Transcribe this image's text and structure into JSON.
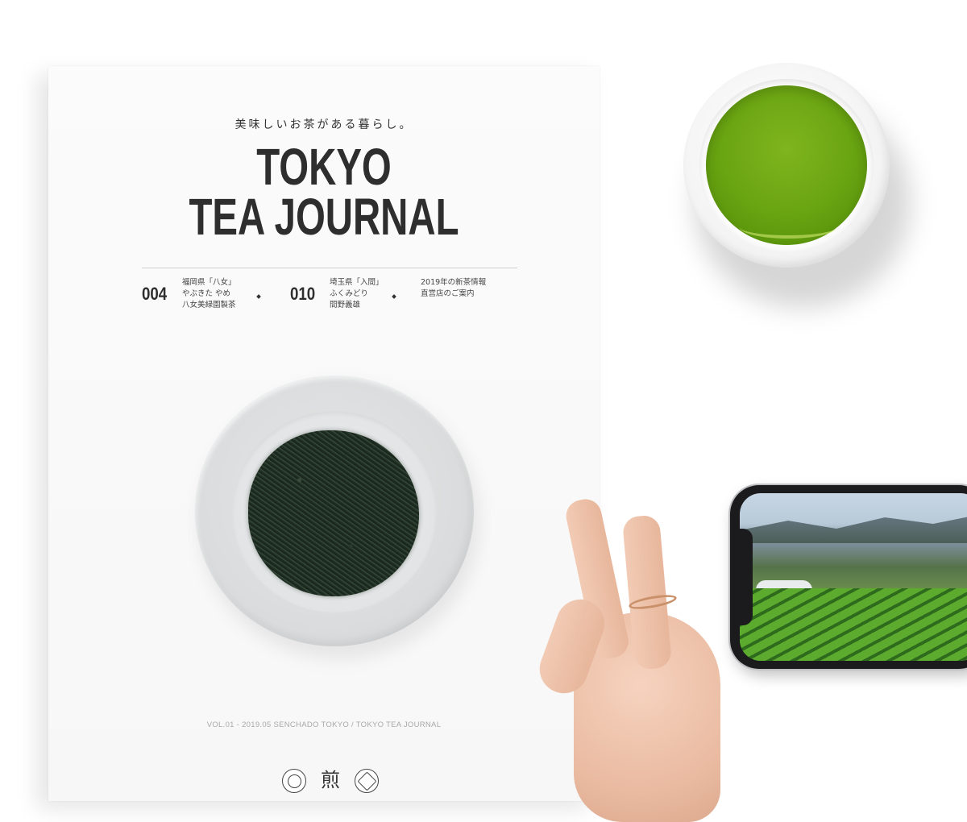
{
  "cover": {
    "tagline": "美味しいお茶がある暮らし。",
    "title_line1": "TOKYO",
    "title_line2": "TEA JOURNAL",
    "toc": [
      {
        "number": "004",
        "lines": [
          "福岡県「八女」",
          "やぶきた やめ",
          "八女美緑園製茶"
        ]
      },
      {
        "number": "010",
        "lines": [
          "埼玉県「入間」",
          "ふくみどり",
          "間野義雄"
        ]
      },
      {
        "number": "",
        "lines": [
          "2019年の新茶情報",
          "直営店のご案内"
        ]
      }
    ],
    "footer": "VOL.01 - 2019.05 SENCHADO TOKYO / TOKYO TEA JOURNAL",
    "crest_mid_glyph": "煎"
  },
  "colors": {
    "tea_green": "#6aa512",
    "title_ink": "#2e2e2e",
    "footer_gray": "#a9a9a9"
  }
}
